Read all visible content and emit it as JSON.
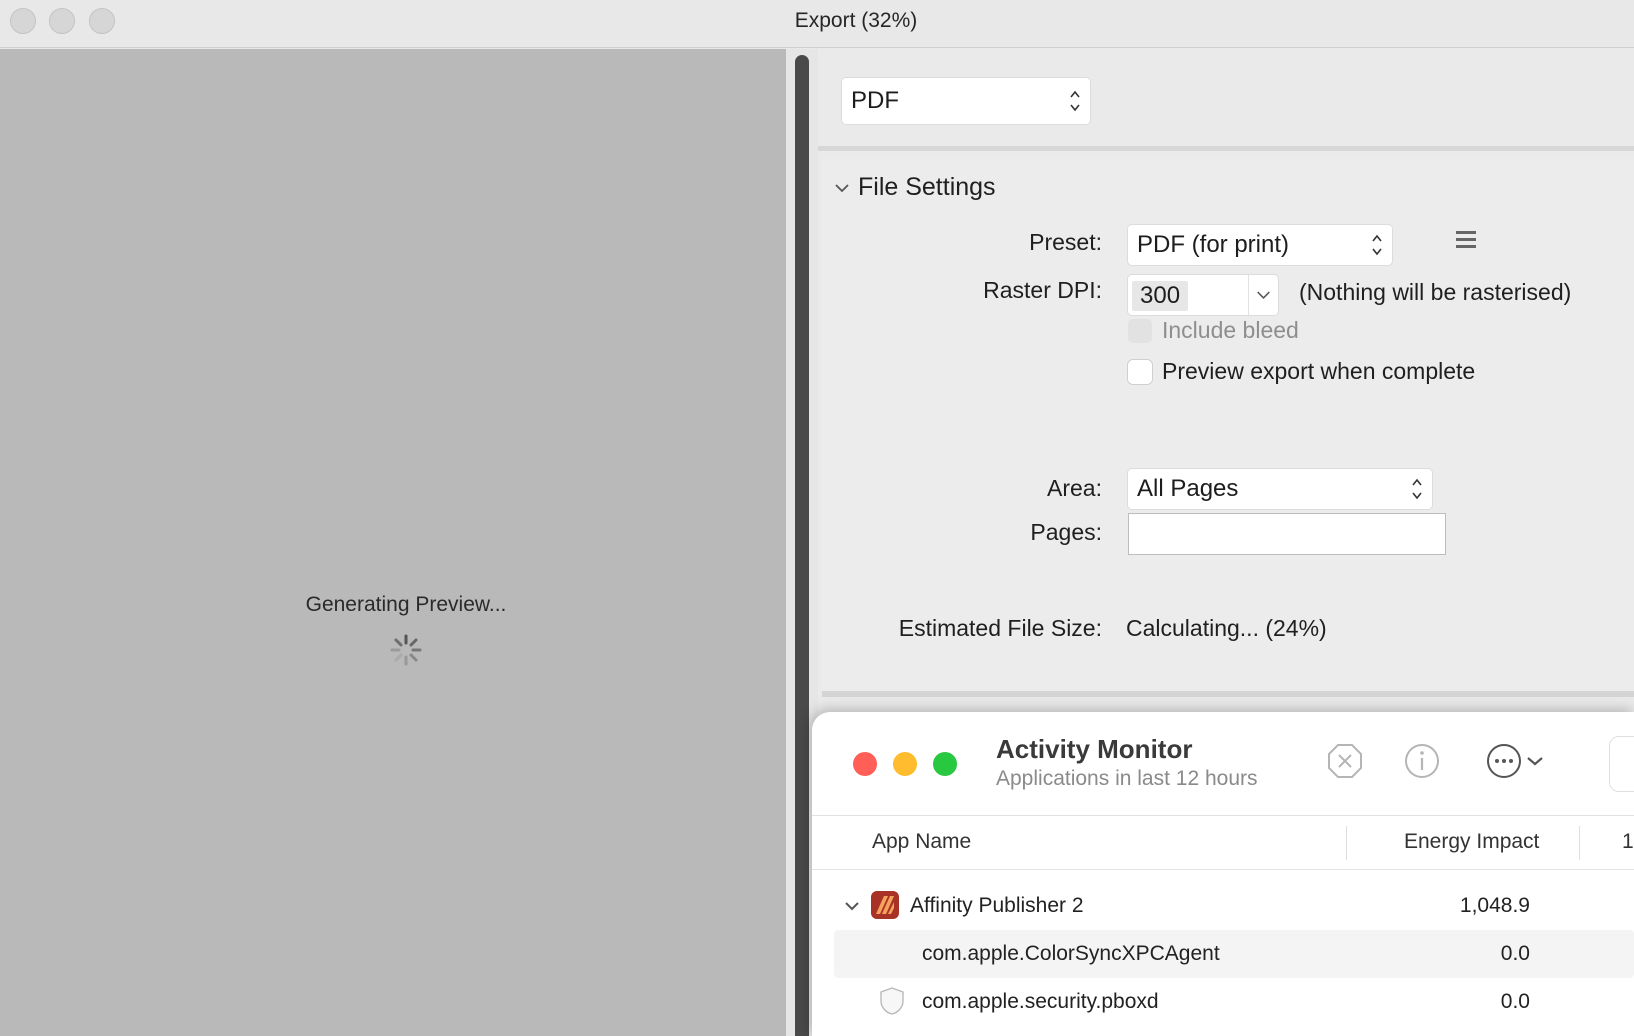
{
  "window": {
    "title": "Export (32%)"
  },
  "preview": {
    "status": "Generating Preview..."
  },
  "format": {
    "selected": "PDF"
  },
  "file_settings": {
    "section_title": "File Settings",
    "preset_label": "Preset:",
    "preset_value": "PDF (for print)",
    "raster_label": "Raster DPI:",
    "raster_value": "300",
    "raster_note": "(Nothing will be rasterised)",
    "include_bleed": "Include bleed",
    "preview_export": "Preview export when complete",
    "area_label": "Area:",
    "area_value": "All Pages",
    "pages_label": "Pages:",
    "pages_value": "",
    "size_label": "Estimated File Size:",
    "size_value": "Calculating... (24%)"
  },
  "activity_monitor": {
    "title": "Activity Monitor",
    "subtitle": "Applications in last 12 hours",
    "columns": [
      "App Name",
      "Energy Impact",
      "1"
    ],
    "rows": [
      {
        "name": "Affinity Publisher 2",
        "energy": "1,048.9"
      },
      {
        "name": "com.apple.ColorSyncXPCAgent",
        "energy": "0.0"
      },
      {
        "name": "com.apple.security.pboxd",
        "energy": "0.0"
      }
    ]
  },
  "colors": {
    "close": "#ff5f57",
    "minimize": "#febc2e",
    "zoom": "#28c840",
    "affinity_icon": "#c0392b"
  },
  "icons": [
    "spinner-icon",
    "up-down-arrows-icon",
    "chevron-down-icon",
    "hamburger-menu-icon",
    "stop-process-icon",
    "info-icon",
    "more-options-icon",
    "affinity-publisher-icon",
    "shield-icon"
  ]
}
